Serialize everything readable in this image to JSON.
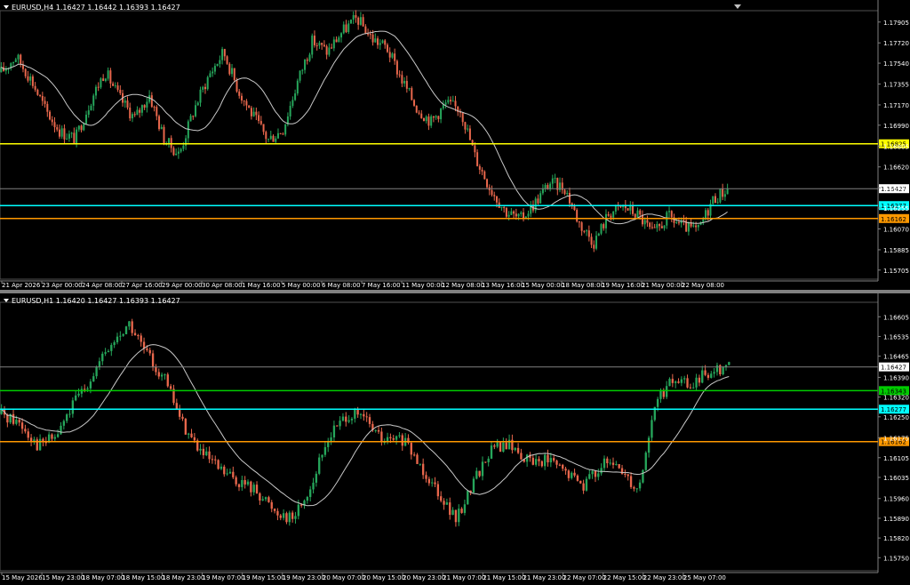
{
  "charts": [
    {
      "title": "EURUSD,H4  1.16427 1.16442 1.16393 1.16427",
      "y_ticks": [
        "1.17905",
        "1.17720",
        "1.17540",
        "1.17355",
        "1.17170",
        "1.16990",
        "1.16805",
        "1.16620",
        "1.16435",
        "1.16255",
        "1.16070",
        "1.15885",
        "1.15705"
      ],
      "x_ticks": [
        "21 Apr 2026",
        "23 Apr 00:00",
        "24 Apr 08:00",
        "27 Apr 16:00",
        "29 Apr 00:00",
        "30 Apr 08:00",
        "1 May 16:00",
        "5 May 00:00",
        "6 May 08:00",
        "7 May 16:00",
        "11 May 00:00",
        "12 May 08:00",
        "13 May 16:00",
        "15 May 00:00",
        "18 May 08:00",
        "19 May 16:00",
        "21 May 00:00",
        "22 May 08:00"
      ],
      "levels": [
        {
          "label": "1.16825",
          "value": 1.16825,
          "color": "#ffff00",
          "text_color": "#000000"
        },
        {
          "label": "1.16427",
          "value": 1.16427,
          "color": "#808080",
          "text_color": "#000000",
          "box": "#ffffff"
        },
        {
          "label": "1.16277",
          "value": 1.16277,
          "color": "#00ffff",
          "text_color": "#000000"
        },
        {
          "label": "1.16162",
          "value": 1.16162,
          "color": "#ff9900",
          "text_color": "#000000"
        }
      ]
    },
    {
      "title": "EURUSD,H1  1.16420 1.16427 1.16393 1.16427",
      "y_ticks": [
        "1.16605",
        "1.16535",
        "1.16465",
        "1.16390",
        "1.16320",
        "1.16250",
        "1.16175",
        "1.16105",
        "1.16035",
        "1.15960",
        "1.15890",
        "1.15820",
        "1.15750"
      ],
      "x_ticks": [
        "15 May 2026",
        "15 May 23:00",
        "18 May 07:00",
        "18 May 15:00",
        "18 May 23:00",
        "19 May 07:00",
        "19 May 15:00",
        "19 May 23:00",
        "20 May 07:00",
        "20 May 15:00",
        "20 May 23:00",
        "21 May 07:00",
        "21 May 15:00",
        "21 May 23:00",
        "22 May 07:00",
        "22 May 15:00",
        "22 May 23:00",
        "25 May 07:00"
      ],
      "levels": [
        {
          "label": "1.16427",
          "value": 1.16427,
          "color": "#808080",
          "text_color": "#000000",
          "box": "#ffffff"
        },
        {
          "label": "1.16343",
          "value": 1.16343,
          "color": "#00cc00",
          "text_color": "#000000"
        },
        {
          "label": "1.16277",
          "value": 1.16277,
          "color": "#00ffff",
          "text_color": "#000000"
        },
        {
          "label": "1.16162",
          "value": 1.16162,
          "color": "#ff9900",
          "text_color": "#000000"
        }
      ]
    }
  ],
  "chart_data": [
    {
      "type": "candlestick",
      "symbol": "EURUSD",
      "timeframe": "H4",
      "ohlc_last": {
        "open": 1.16427,
        "high": 1.16442,
        "low": 1.16393,
        "close": 1.16427
      },
      "ylim": [
        1.1564,
        1.1799
      ],
      "moving_average": true,
      "colors": {
        "up": "#26a65b",
        "down": "#e8674c",
        "ma": "#c8c8c8"
      },
      "close_path": [
        [
          0,
          1.1746
        ],
        [
          6,
          1.176
        ],
        [
          12,
          1.174
        ],
        [
          18,
          1.1712
        ],
        [
          24,
          1.1693
        ],
        [
          30,
          1.1687
        ],
        [
          36,
          1.172
        ],
        [
          42,
          1.1747
        ],
        [
          48,
          1.1723
        ],
        [
          54,
          1.1705
        ],
        [
          60,
          1.1726
        ],
        [
          66,
          1.1686
        ],
        [
          72,
          1.1673
        ],
        [
          78,
          1.1713
        ],
        [
          84,
          1.1743
        ],
        [
          90,
          1.1764
        ],
        [
          96,
          1.173
        ],
        [
          102,
          1.1707
        ],
        [
          108,
          1.1686
        ],
        [
          114,
          1.1695
        ],
        [
          120,
          1.1738
        ],
        [
          126,
          1.1774
        ],
        [
          132,
          1.1764
        ],
        [
          138,
          1.1782
        ],
        [
          144,
          1.1794
        ],
        [
          150,
          1.1776
        ],
        [
          156,
          1.1768
        ],
        [
          162,
          1.174
        ],
        [
          168,
          1.1715
        ],
        [
          174,
          1.1702
        ],
        [
          180,
          1.1718
        ],
        [
          186,
          1.1713
        ],
        [
          192,
          1.167
        ],
        [
          198,
          1.1643
        ],
        [
          204,
          1.1623
        ],
        [
          210,
          1.1615
        ],
        [
          216,
          1.163
        ],
        [
          222,
          1.1648
        ],
        [
          228,
          1.1644
        ],
        [
          234,
          1.1612
        ],
        [
          240,
          1.1595
        ],
        [
          246,
          1.1621
        ],
        [
          252,
          1.1627
        ],
        [
          258,
          1.1619
        ],
        [
          264,
          1.1602
        ],
        [
          270,
          1.1618
        ],
        [
          276,
          1.1609
        ],
        [
          282,
          1.1605
        ],
        [
          288,
          1.1633
        ],
        [
          294,
          1.16427
        ]
      ],
      "candle_count": 300
    },
    {
      "type": "candlestick",
      "symbol": "EURUSD",
      "timeframe": "H1",
      "ohlc_last": {
        "open": 1.1642,
        "high": 1.16427,
        "low": 1.16393,
        "close": 1.16427
      },
      "ylim": [
        1.1571,
        1.1665
      ],
      "moving_average": true,
      "colors": {
        "up": "#26a65b",
        "down": "#e8674c",
        "ma": "#c8c8c8"
      },
      "close_path": [
        [
          0,
          1.1626
        ],
        [
          6,
          1.1623
        ],
        [
          12,
          1.1615
        ],
        [
          18,
          1.1618
        ],
        [
          24,
          1.163
        ],
        [
          30,
          1.164
        ],
        [
          36,
          1.165
        ],
        [
          42,
          1.1658
        ],
        [
          48,
          1.1647
        ],
        [
          54,
          1.1638
        ],
        [
          60,
          1.1622
        ],
        [
          66,
          1.1612
        ],
        [
          72,
          1.1606
        ],
        [
          78,
          1.1602
        ],
        [
          84,
          1.1599
        ],
        [
          90,
          1.1592
        ],
        [
          96,
          1.1589
        ],
        [
          102,
          1.16
        ],
        [
          108,
          1.1618
        ],
        [
          114,
          1.1626
        ],
        [
          120,
          1.1624
        ],
        [
          126,
          1.1616
        ],
        [
          132,
          1.1617
        ],
        [
          138,
          1.1608
        ],
        [
          144,
          1.1599
        ],
        [
          150,
          1.1588
        ],
        [
          156,
          1.1603
        ],
        [
          162,
          1.1614
        ],
        [
          168,
          1.1615
        ],
        [
          174,
          1.1609
        ],
        [
          180,
          1.161
        ],
        [
          186,
          1.1605
        ],
        [
          192,
          1.1601
        ],
        [
          198,
          1.1608
        ],
        [
          204,
          1.1607
        ],
        [
          210,
          1.1599
        ],
        [
          216,
          1.1631
        ],
        [
          222,
          1.1638
        ],
        [
          228,
          1.1636
        ],
        [
          234,
          1.1642
        ],
        [
          240,
          1.16427
        ]
      ],
      "candle_count": 246
    }
  ]
}
